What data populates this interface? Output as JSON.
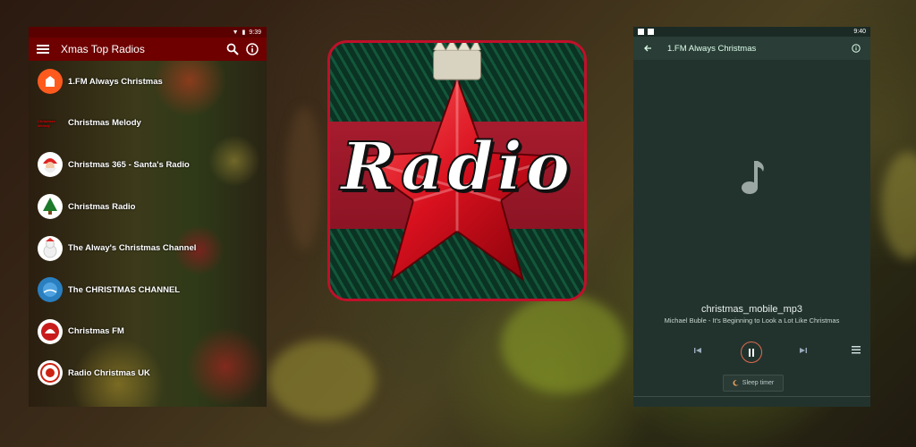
{
  "left_phone": {
    "status_time": "9:39",
    "app_title": "Xmas Top Radios",
    "stations": [
      {
        "name": "1.FM  Always Christmas",
        "logo": "fm"
      },
      {
        "name": "Christmas Melody",
        "logo": "Christmas Melody"
      },
      {
        "name": "Christmas 365 - Santa's Radio",
        "logo": "santa"
      },
      {
        "name": "Christmas Radio",
        "logo": "tree"
      },
      {
        "name": "The Alway's Christmas Channel",
        "logo": "snowman"
      },
      {
        "name": "The CHRISTMAS CHANNEL",
        "logo": "channel"
      },
      {
        "name": "Christmas FM",
        "logo": "FM"
      },
      {
        "name": "Radio Christmas UK",
        "logo": "UK"
      }
    ]
  },
  "center_icon": {
    "text": "Radio"
  },
  "right_phone": {
    "status_time": "9:40",
    "station_title": "1.FM  Always Christmas",
    "track_title": "christmas_mobile_mp3",
    "track_subtitle": "Michael Buble - It's Beginning to Look a Lot Like Christmas",
    "sleep_timer_label": "Sleep timer"
  },
  "colors": {
    "left_appbar": "#6e0000",
    "right_bg": "#22332d",
    "icon_border": "#c0102a",
    "play_ring": "#e06a50"
  }
}
